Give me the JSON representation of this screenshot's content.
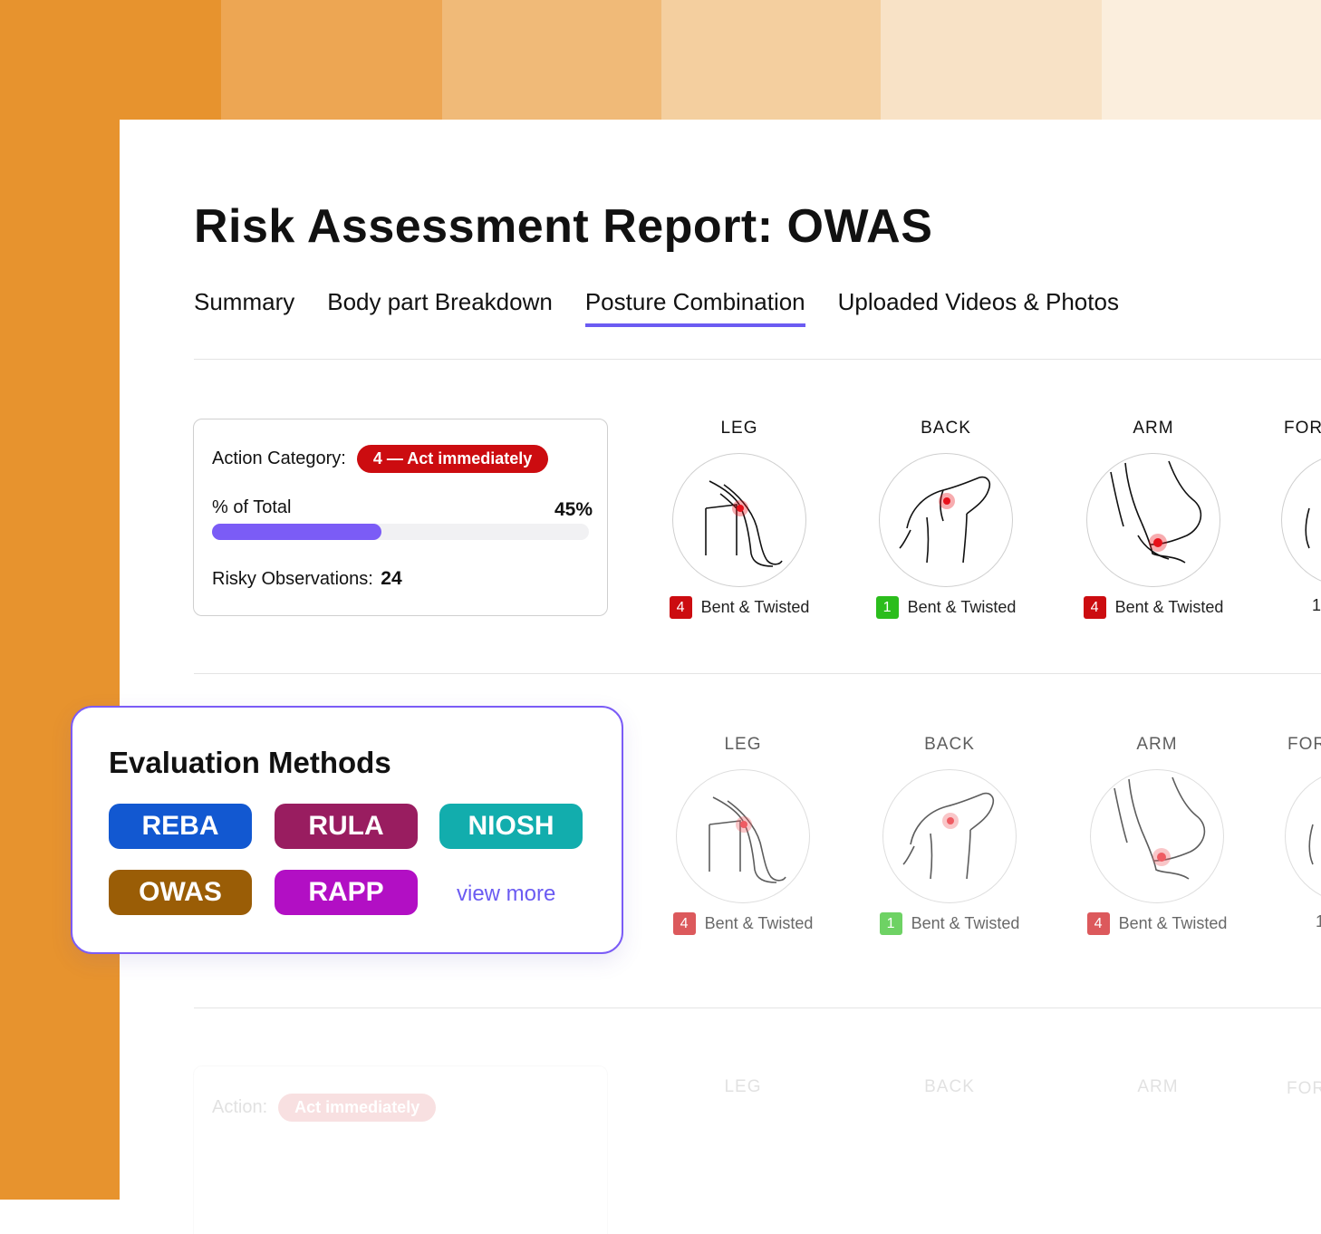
{
  "background": {
    "swatches": [
      "#e7932e",
      "#eda653",
      "#f0ba78",
      "#f4cf9f",
      "#f8e2c6",
      "#fbeedd"
    ]
  },
  "report": {
    "title": "Risk Assessment Report: OWAS",
    "tabs": [
      {
        "label": "Summary",
        "active": false
      },
      {
        "label": "Body part Breakdown",
        "active": false
      },
      {
        "label": "Posture Combination",
        "active": true
      },
      {
        "label": "Uploaded Videos & Photos",
        "active": false
      }
    ]
  },
  "combination_1": {
    "action_label": "Action Category:",
    "action_badge": "4 — Act immediately",
    "percent_label": "% of Total",
    "percent_value": "45%",
    "percent_fraction": 0.45,
    "observations_label": "Risky Observations:",
    "observations_value": "24",
    "body_parts": [
      {
        "title": "LEG",
        "score": "4",
        "caption": "Bent & Twisted",
        "score_color": "#cc0c10",
        "icon": "leg-icon"
      },
      {
        "title": "BACK",
        "score": "1",
        "caption": "Bent & Twisted",
        "score_color": "#2bbd1c",
        "icon": "back-icon"
      },
      {
        "title": "ARM",
        "score": "4",
        "caption": "Bent & Twisted",
        "score_color": "#cc0c10",
        "icon": "arm-icon"
      },
      {
        "title": "FOR",
        "score": "1",
        "caption": "",
        "score_color": "#cc0c10",
        "icon": "forearm-icon"
      }
    ]
  },
  "combination_2": {
    "body_parts": [
      {
        "title": "LEG",
        "score": "4",
        "caption": "Bent & Twisted",
        "score_color": "#cc0c10",
        "icon": "leg-icon"
      },
      {
        "title": "BACK",
        "score": "1",
        "caption": "Bent & Twisted",
        "score_color": "#2bbd1c",
        "icon": "back-icon"
      },
      {
        "title": "ARM",
        "score": "4",
        "caption": "Bent & Twisted",
        "score_color": "#cc0c10",
        "icon": "arm-icon"
      },
      {
        "title": "FOR",
        "score": "1",
        "caption": "",
        "score_color": "#cc0c10",
        "icon": "forearm-icon"
      }
    ]
  },
  "combination_3": {
    "action_label": "Action:",
    "action_badge": "Act immediately",
    "body_parts": [
      {
        "title": "LEG"
      },
      {
        "title": "BACK"
      },
      {
        "title": "ARM"
      },
      {
        "title": "FOR"
      }
    ]
  },
  "evaluation_methods": {
    "title": "Evaluation Methods",
    "methods": [
      {
        "label": "REBA",
        "color": "#1258d1"
      },
      {
        "label": "RULA",
        "color": "#991d60"
      },
      {
        "label": "NIOSH",
        "color": "#12adad"
      },
      {
        "label": "OWAS",
        "color": "#9a5d06"
      },
      {
        "label": "RAPP",
        "color": "#b20fc4"
      }
    ],
    "view_more": "view more"
  }
}
